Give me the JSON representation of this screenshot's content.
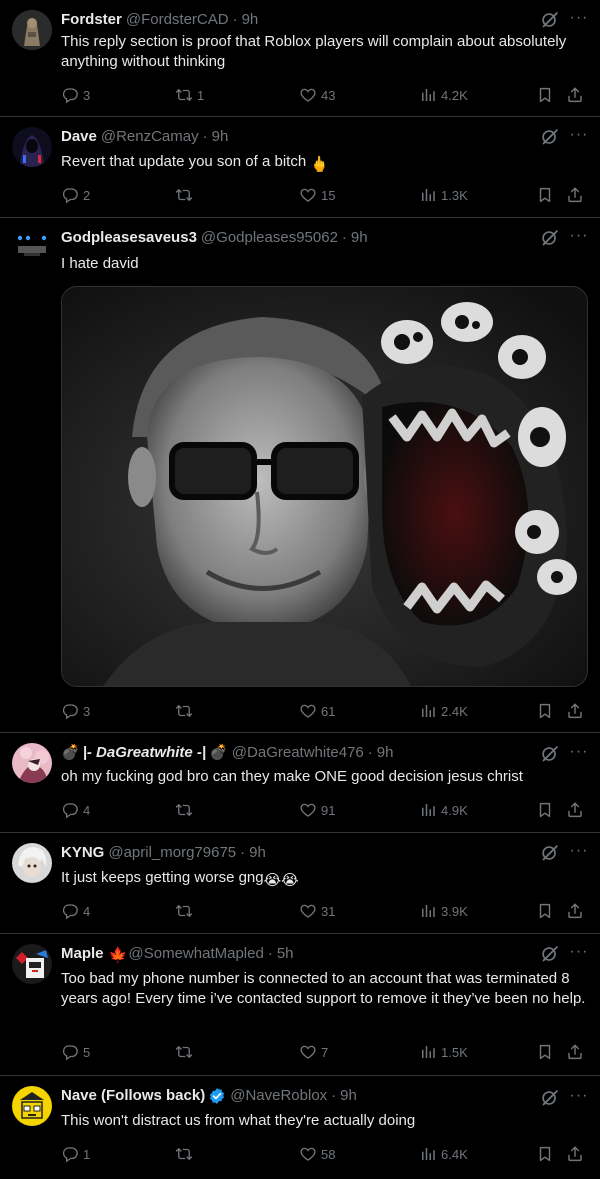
{
  "colors": {
    "background": "#000000",
    "text": "#e7e9ea",
    "muted": "#71767b",
    "divider": "#2f3336",
    "verified": "#1d9bf0"
  },
  "posts": [
    {
      "name": "Fordster",
      "handle": "@FordsterCAD",
      "time": "9h",
      "text": "This reply section is proof that Roblox players will complain about absolutely anything without thinking",
      "replies": "3",
      "reposts": "1",
      "likes": "43",
      "views": "4.2K"
    },
    {
      "name": "Dave",
      "handle": "@RenzCamay",
      "time": "9h",
      "text": "Revert that update you son of a bitch",
      "emoji": "🖕",
      "replies": "2",
      "reposts": "",
      "likes": "15",
      "views": "1.3K"
    },
    {
      "name": "Godpleasesaveus3",
      "handle": "@Godpleases95062",
      "time": "9h",
      "text": "I hate david",
      "replies": "3",
      "reposts": "",
      "likes": "61",
      "views": "2.4K"
    },
    {
      "name_prefix": "💣",
      "name": "|- DaGreatwhite -|",
      "name_suffix": "💣",
      "handle": "@DaGreatwhite476",
      "time": "9h",
      "text": "oh my fucking god bro can they make ONE good decision jesus christ",
      "replies": "4",
      "reposts": "",
      "likes": "91",
      "views": "4.9K"
    },
    {
      "name": "KYNG",
      "handle": "@april_morg79675",
      "time": "9h",
      "text": "It just keeps getting worse gng",
      "emoji": "😭😭",
      "replies": "4",
      "reposts": "",
      "likes": "31",
      "views": "3.9K"
    },
    {
      "name": "Maple",
      "flag": "🍁",
      "handle": "@SomewhatMapled",
      "time": "5h",
      "text": "Too bad my phone number is connected to an account that was terminated 8 years ago! Every time i’ve contacted support to remove it they’ve been no help.",
      "replies": "5",
      "reposts": "",
      "likes": "7",
      "views": "1.5K"
    },
    {
      "name": "Nave (Follows back)",
      "handle": "@NaveRoblox",
      "time": "9h",
      "text": "This won't distract us from what they're actually doing",
      "replies": "1",
      "reposts": "",
      "likes": "58",
      "views": "6.4K"
    }
  ],
  "ui": {
    "dot": "·",
    "more": "···"
  }
}
